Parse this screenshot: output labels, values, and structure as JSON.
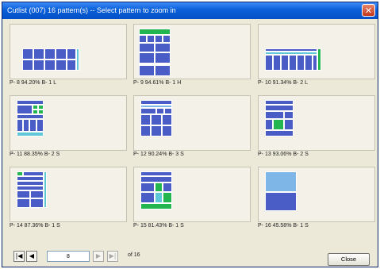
{
  "window": {
    "title": "Cutlist (007) 16 pattern(s) -- Select pattern to zoom in",
    "close_glyph": "✕"
  },
  "colors": {
    "piece_blue": "#4a5dc7",
    "piece_green": "#22b550",
    "piece_pink": "#e07aa8",
    "piece_cyan": "#5ec7d8",
    "piece_lightblue": "#7fb6e8"
  },
  "patterns": [
    {
      "label": "P- 8  94.20% B-   1 L"
    },
    {
      "label": "P- 9  94.61% B-   1 H"
    },
    {
      "label": "P- 10  91.34% B-   2 L"
    },
    {
      "label": "P- 11  88.35% B-   2 S"
    },
    {
      "label": "P- 12  90.24% B-   3 S"
    },
    {
      "label": "P- 13  93.06% B-   2 S"
    },
    {
      "label": "P- 14  87.36% B-   1 S"
    },
    {
      "label": "P- 15  81.43% B-   1 S"
    },
    {
      "label": "P- 16  45.58% B-   1 S"
    }
  ],
  "pager": {
    "first_glyph": "|◀",
    "prev_glyph": "◀",
    "next_glyph": "▶",
    "last_glyph": "▶|",
    "current_page": "8",
    "of_label": "of 16"
  },
  "close_button_label": "Close"
}
